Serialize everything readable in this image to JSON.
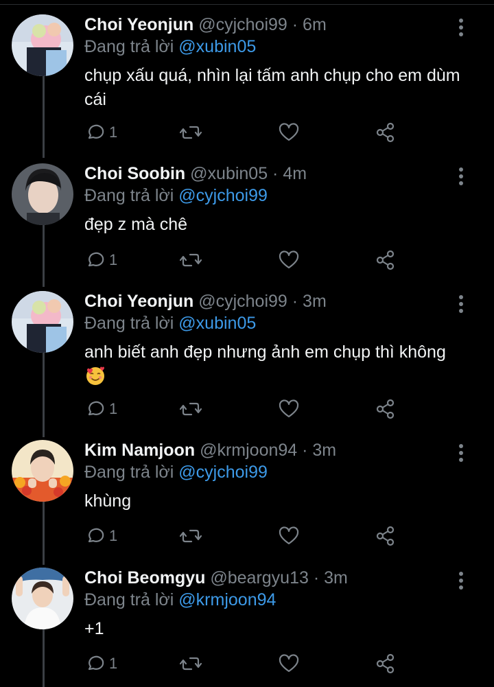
{
  "reply_prefix": "Đang trả lời",
  "tweets": [
    {
      "name": "Choi Yeonjun",
      "meta": "@cyjchoi99 · 6m",
      "reply_to": "@xubin05",
      "text": "chụp xấu quá, nhìn lại tấm anh chụp cho em dùm cái",
      "reply_count": "1",
      "avatar": "photo-pink-jacket"
    },
    {
      "name": "Choi Soobin",
      "meta": "@xubin05 · 4m",
      "reply_to": "@cyjchoi99",
      "text": "đẹp z mà chê",
      "reply_count": "1",
      "avatar": "photo-portrait"
    },
    {
      "name": "Choi Yeonjun",
      "meta": "@cyjchoi99 · 3m",
      "reply_to": "@xubin05",
      "text": "anh biết anh đẹp nhưng ảnh em chụp thì không",
      "emoji": "smiling-face-with-hearts",
      "reply_count": "1",
      "avatar": "photo-pink-jacket"
    },
    {
      "name": "Kim Namjoon",
      "meta": "@krmjoon94 · 3m",
      "reply_to": "@cyjchoi99",
      "text": "khùng",
      "reply_count": "1",
      "avatar": "photo-flowers"
    },
    {
      "name": "Choi Beomgyu",
      "meta": "@beargyu13 · 3m",
      "reply_to": "@krmjoon94",
      "text": "+1",
      "reply_count": "1",
      "avatar": "photo-white-shirt"
    }
  ],
  "icons": {
    "reply": "reply-icon",
    "retweet": "retweet-icon",
    "like": "heart-icon",
    "share": "share-icon",
    "more": "more-vertical-icon"
  },
  "colors": {
    "background": "#000000",
    "name": "#f1f3f4",
    "secondary": "#7d848b",
    "mention": "#3d9ae8",
    "thread_line": "#3b3f44"
  }
}
